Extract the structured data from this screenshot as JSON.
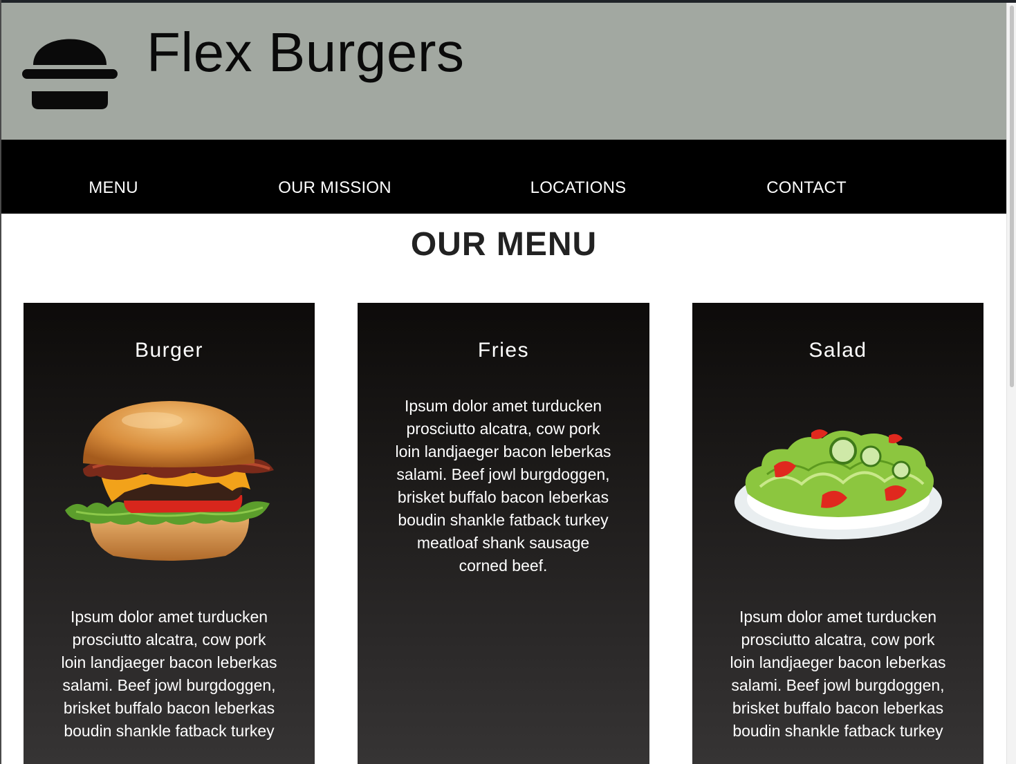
{
  "header": {
    "logo_icon": "burger-icon",
    "brand": "Flex Burgers",
    "background": "#a2a8a1"
  },
  "nav": {
    "items": [
      {
        "label": "MENU"
      },
      {
        "label": "OUR MISSION"
      },
      {
        "label": "LOCATIONS"
      },
      {
        "label": "CONTACT"
      }
    ]
  },
  "main": {
    "title": "OUR MENU",
    "cards": [
      {
        "title": "Burger",
        "image": "burger-image",
        "text": "Ipsum dolor amet turducken prosciutto alcatra, cow pork loin landjaeger bacon leberkas salami. Beef jowl burgdoggen, brisket buffalo bacon leberkas boudin shankle fatback turkey"
      },
      {
        "title": "Fries",
        "text": "Ipsum dolor amet turducken prosciutto alcatra, cow pork loin landjaeger bacon leberkas salami. Beef jowl burgdoggen, brisket buffalo bacon leberkas boudin shankle fatback turkey meatloaf shank sausage corned beef."
      },
      {
        "title": "Salad",
        "image": "salad-image",
        "text": "Ipsum dolor amet turducken prosciutto alcatra, cow pork loin landjaeger bacon leberkas salami. Beef jowl burgdoggen, brisket buffalo bacon leberkas boudin shankle fatback turkey"
      }
    ]
  }
}
